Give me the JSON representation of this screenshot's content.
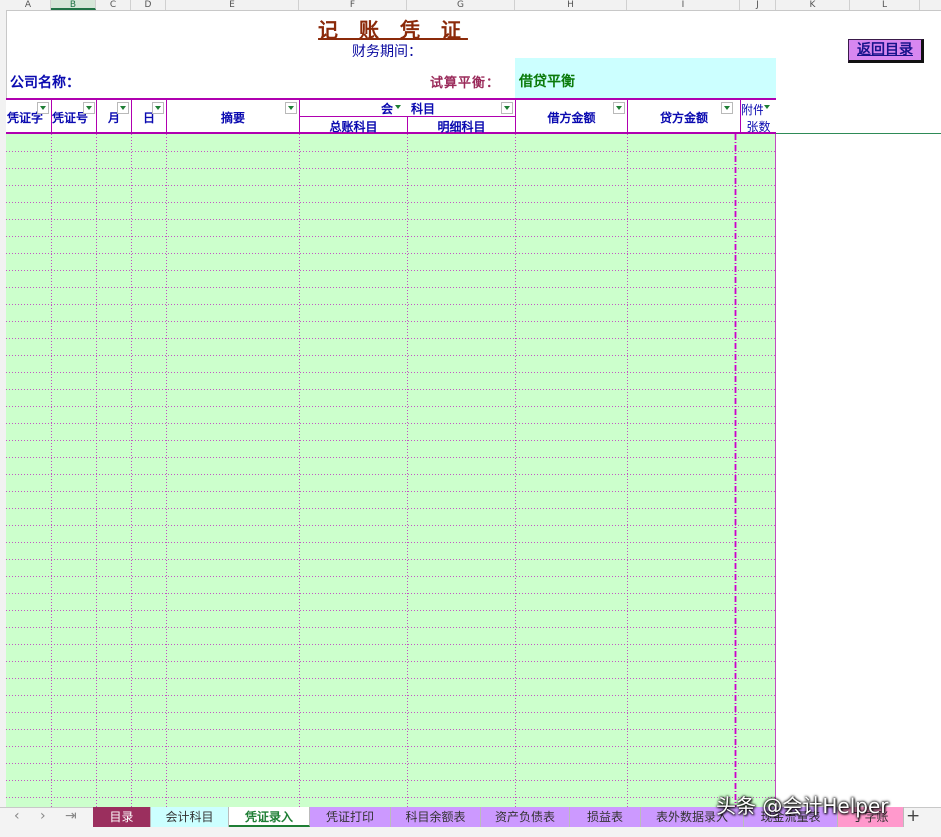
{
  "columns": [
    "A",
    "B",
    "C",
    "D",
    "E",
    "F",
    "G",
    "H",
    "I",
    "J",
    "K",
    "L"
  ],
  "selected_column": "B",
  "sheet": {
    "title": "记 账 凭 证",
    "period_label": "财务期间：",
    "back_button": "返回目录",
    "company_label": "公司名称：",
    "trial_label": "试算平衡：",
    "trial_value": "借贷平衡"
  },
  "table": {
    "headers": {
      "voucher_type": "凭证字",
      "voucher_no": "凭证号",
      "month": "月",
      "day": "日",
      "summary": "摘要",
      "account_group": "会",
      "account_group_suffix": "科目",
      "general_account": "总账科目",
      "detail_account": "明细科目",
      "debit": "借方金额",
      "credit": "贷方金额",
      "attach_top": "附件",
      "attach_bottom": "张数"
    }
  },
  "tabs": [
    {
      "label": "目录",
      "bg": "#9b2f5e",
      "color": "#ffffff"
    },
    {
      "label": "会计科目",
      "bg": "#ccffff",
      "color": "#333333"
    },
    {
      "label": "凭证录入",
      "bg": "#ffffff",
      "color": "#1e7e34",
      "active": true
    },
    {
      "label": "凭证打印",
      "bg": "#cc99ff",
      "color": "#333333"
    },
    {
      "label": "科目余额表",
      "bg": "#cc99ff",
      "color": "#333333"
    },
    {
      "label": "资产负债表",
      "bg": "#cc99ff",
      "color": "#333333"
    },
    {
      "label": "损益表",
      "bg": "#cc99ff",
      "color": "#333333"
    },
    {
      "label": "表外数据录入",
      "bg": "#cc99ff",
      "color": "#333333"
    },
    {
      "label": "现金流量表",
      "bg": "#cc99ff",
      "color": "#333333"
    },
    {
      "label": "丁字账",
      "bg": "#ff99cc",
      "color": "#333333"
    }
  ],
  "nav_arrows": [
    "‹",
    "›",
    "⇥"
  ],
  "add_sheet": "+",
  "watermark": "头条 @会计Helper"
}
